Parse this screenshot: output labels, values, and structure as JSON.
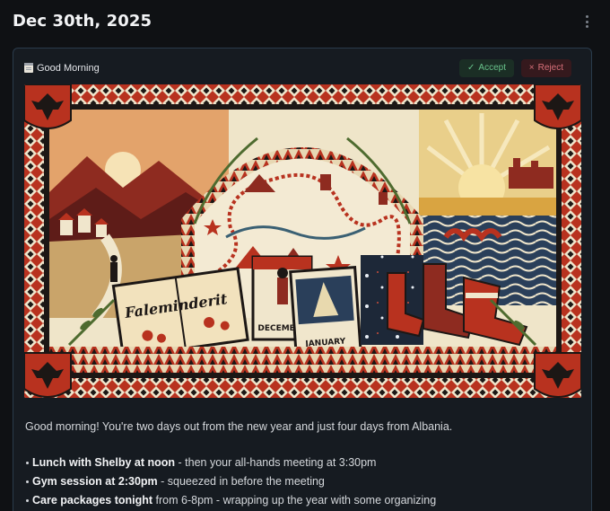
{
  "header": {
    "title": "Dec 30th, 2025",
    "more_icon": "more-vertical-icon"
  },
  "card": {
    "title": "Good Morning",
    "title_icon": "notepad-icon",
    "accept_label": "Accept",
    "accept_icon_glyph": "✓",
    "reject_label": "Reject",
    "reject_icon_glyph": "×",
    "colors": {
      "accent_green": "#68c28b",
      "accent_red": "#d8707a",
      "card_border": "#2a3b4b"
    }
  },
  "illustration": {
    "book_text": "Faleminderit",
    "calendar_dec": "DECEMBER",
    "calendar_jan": "JANUARY",
    "colors": {
      "red": "#b8321f",
      "black": "#1c1715",
      "cream": "#f0e6cc",
      "gold": "#d9a441",
      "navy": "#2a3f5a"
    }
  },
  "content": {
    "intro": "Good morning! You're two days out from the new year and just four days from Albania.",
    "items": [
      {
        "bold": "Lunch with Shelby at noon",
        "rest": " - then your all-hands meeting at 3:30pm"
      },
      {
        "bold": "Gym session at 2:30pm",
        "rest": " - squeezed in before the meeting"
      },
      {
        "bold": "Care packages tonight",
        "rest": " from 6-8pm - wrapping up the year with some organizing"
      }
    ]
  }
}
